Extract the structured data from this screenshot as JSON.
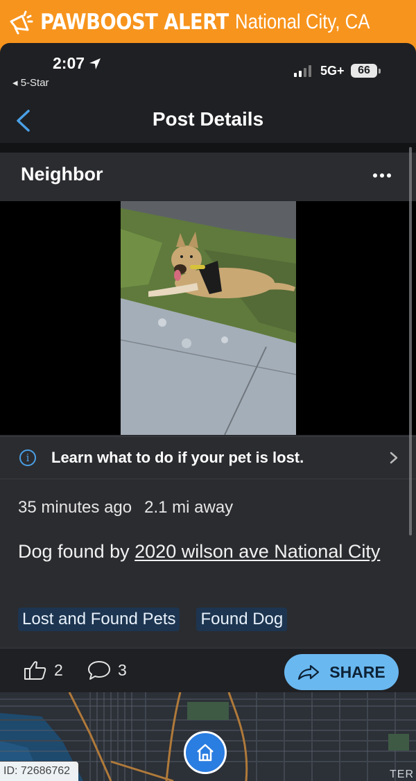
{
  "alert": {
    "brand": "PAWBOOST ALERT",
    "location": "National City, CA"
  },
  "status_bar": {
    "time": "2:07",
    "back_app": "5-Star",
    "network": "5G+",
    "battery": "66"
  },
  "nav": {
    "title": "Post Details"
  },
  "post": {
    "author": "Neighbor",
    "info_link": "Learn what to do if your pet is lost.",
    "time_ago": "35 minutes ago",
    "distance": "2.1 mi away",
    "description_prefix": "Dog found by",
    "description_link": "2020 wilson ave National City",
    "tags": [
      "Lost and Found Pets",
      "Found Dog"
    ],
    "likes": "2",
    "comments": "3",
    "share_label": "SHARE"
  },
  "footer": {
    "id_label": "ID: 72686762",
    "map_fragment": "TER"
  },
  "colors": {
    "brand_orange": "#f7941d",
    "accent_blue": "#6ab8f0",
    "tag_bg": "#1d3550",
    "card_bg": "#2b2c30"
  }
}
